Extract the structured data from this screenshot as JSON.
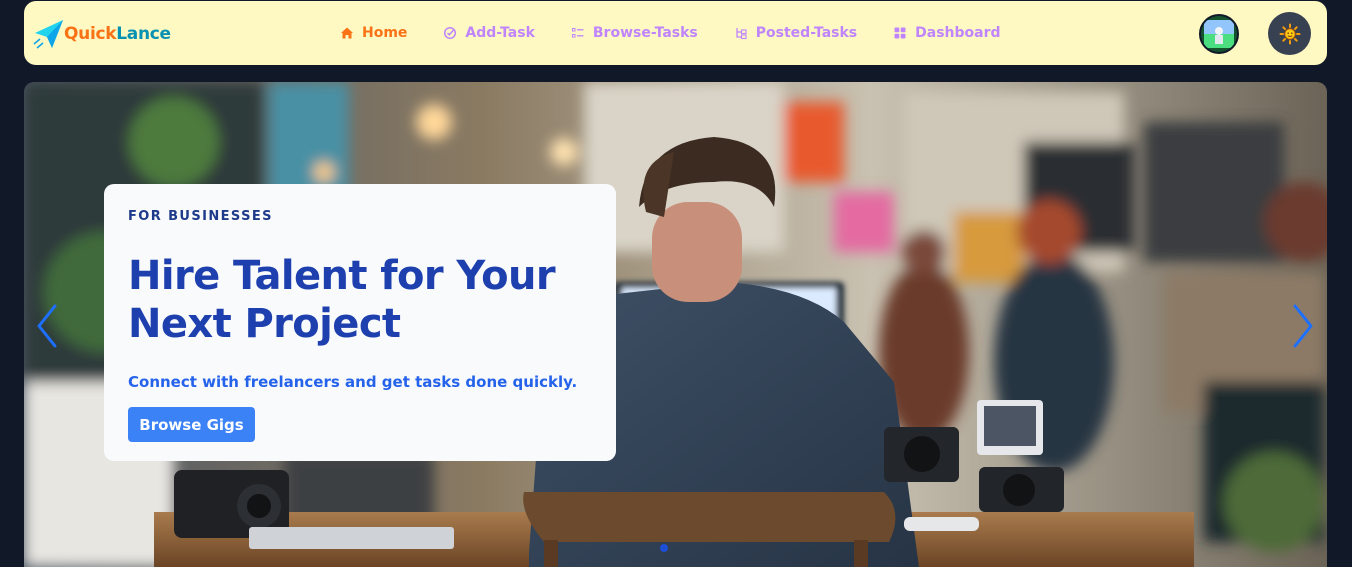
{
  "brand": {
    "name_part1": "Quick",
    "name_part2": "Lance",
    "icon": "paper-plane-icon",
    "color_part1": "#f97316",
    "color_part2": "#0891b2"
  },
  "nav": {
    "items": [
      {
        "label": "Home",
        "icon": "home-icon",
        "active": true
      },
      {
        "label": "Add-Task",
        "icon": "add-task-icon",
        "active": false
      },
      {
        "label": "Browse-Tasks",
        "icon": "list-icon",
        "active": false
      },
      {
        "label": "Posted-Tasks",
        "icon": "posted-icon",
        "active": false
      },
      {
        "label": "Dashboard",
        "icon": "dashboard-icon",
        "active": false
      }
    ],
    "active_color": "#f97316",
    "inactive_color": "#c084fc"
  },
  "user": {
    "avatar": "user-avatar-icon"
  },
  "theme_toggle": {
    "icon": "sun-icon"
  },
  "hero": {
    "slide": {
      "kicker": "FOR BUSINESSES",
      "title": "Hire Talent for Your Next Project",
      "subtitle": "Connect with freelancers and get tasks done quickly.",
      "cta": "Browse Gigs"
    },
    "prev_icon": "chevron-left-icon",
    "next_icon": "chevron-right-icon",
    "pagination": {
      "current": 1,
      "total": 1
    }
  },
  "colors": {
    "page_bg": "#111827",
    "navbar_bg": "#fef9c3",
    "accent": "#3b82f6",
    "title_blue": "#1e40af"
  }
}
